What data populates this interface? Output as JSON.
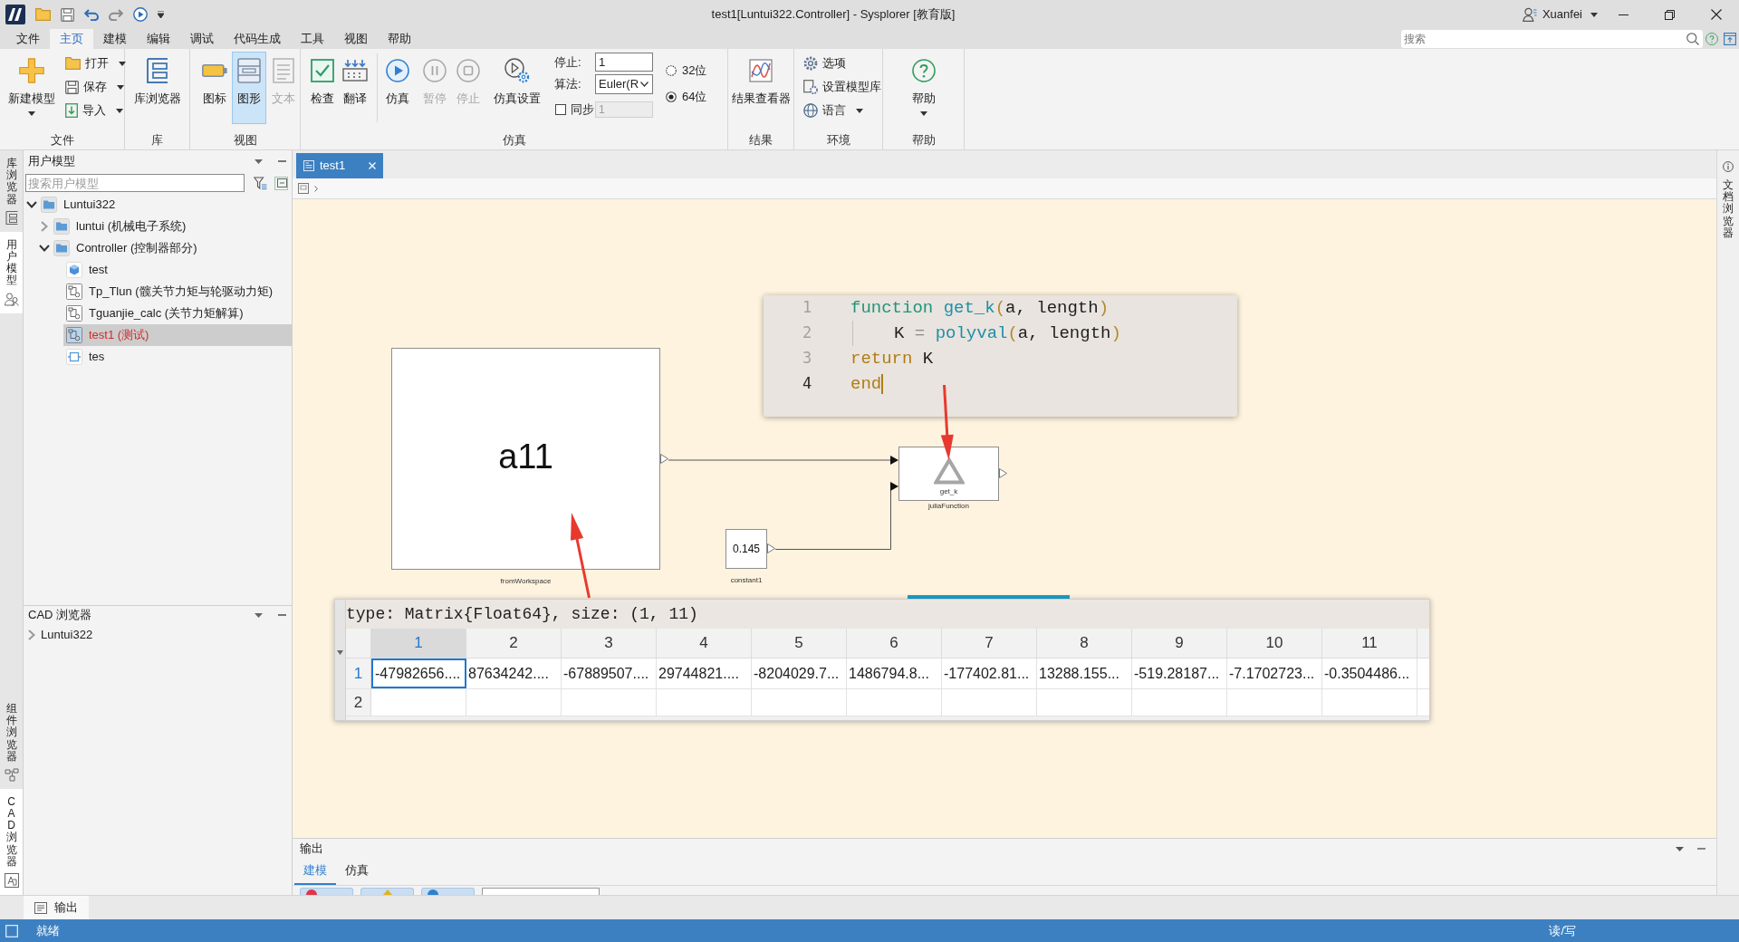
{
  "window": {
    "title": "test1[Luntui322.Controller] - Sysplorer [教育版]",
    "user": "Xuanfei"
  },
  "menu_tabs": [
    {
      "label": "文件",
      "selected": false
    },
    {
      "label": "主页",
      "selected": true
    },
    {
      "label": "建模",
      "selected": false
    },
    {
      "label": "编辑",
      "selected": false
    },
    {
      "label": "调试",
      "selected": false
    },
    {
      "label": "代码生成",
      "selected": false
    },
    {
      "label": "工具",
      "selected": false
    },
    {
      "label": "视图",
      "selected": false
    },
    {
      "label": "帮助",
      "selected": false
    }
  ],
  "global_search": {
    "placeholder": "搜索"
  },
  "ribbon": {
    "file_group": {
      "label": "文件",
      "new_model": {
        "label": "新建模型",
        "dropdown": true
      },
      "actions": [
        {
          "label": "打开",
          "dropdown": true
        },
        {
          "label": "保存",
          "dropdown": true
        },
        {
          "label": "导入",
          "dropdown": true
        }
      ]
    },
    "library_group": {
      "label": "库",
      "library_browser": {
        "label": "库浏览器"
      }
    },
    "view_group": {
      "label": "视图",
      "buttons": [
        {
          "label": "图标",
          "selected": false,
          "disabled": false
        },
        {
          "label": "图形",
          "selected": true,
          "disabled": false
        },
        {
          "label": "文本",
          "selected": false,
          "disabled": true
        }
      ]
    },
    "simulation_group": {
      "label": "仿真",
      "tools": [
        {
          "label": "检查"
        },
        {
          "label": "翻译"
        }
      ],
      "run_buttons": [
        {
          "label": "仿真",
          "disabled": false
        },
        {
          "label": "暂停",
          "disabled": true
        },
        {
          "label": "停止",
          "disabled": true
        }
      ],
      "settings": {
        "label": "仿真设置"
      },
      "stop_time": {
        "label": "停止:",
        "value": "1"
      },
      "algorithm": {
        "label": "算法:",
        "value": "Euler(R"
      },
      "sync": {
        "label": "同步",
        "checked": false
      },
      "sync_value": {
        "value": "1",
        "disabled": true
      },
      "precision": [
        {
          "label": "32位",
          "selected": false
        },
        {
          "label": "64位",
          "selected": true
        }
      ]
    },
    "results_group": {
      "label": "结果",
      "viewer": {
        "label": "结果查看器"
      }
    },
    "environment_group": {
      "label": "环境",
      "items": [
        {
          "label": "选项",
          "dropdown": false
        },
        {
          "label": "设置模型库",
          "dropdown": false
        },
        {
          "label": "语言",
          "dropdown": true
        }
      ]
    },
    "help_group": {
      "label": "帮助",
      "help": {
        "label": "帮助",
        "dropdown": true
      }
    }
  },
  "left_dock": {
    "top_tabs": [
      {
        "label": "库浏览器",
        "selected": false
      },
      {
        "label": "用户模型",
        "selected": true
      }
    ],
    "bottom_tabs": [
      {
        "label": "组件浏览器",
        "selected": false
      },
      {
        "label": "CAD 浏览器",
        "selected": true
      }
    ]
  },
  "user_models": {
    "title": "用户模型",
    "search": {
      "placeholder": "搜索用户模型"
    },
    "tree": [
      {
        "label": "Luntui322",
        "kind": "package",
        "expanded": true,
        "selected": false,
        "children": [
          {
            "label": "luntui (机械电子系统)",
            "kind": "package",
            "expanded": false,
            "selected": false
          },
          {
            "label": "Controller (控制器部分)",
            "kind": "package",
            "expanded": true,
            "selected": false,
            "children": [
              {
                "label": "test",
                "kind": "class",
                "selected": false
              },
              {
                "label": "Tp_Tlun (髋关节力矩与轮驱动力矩)",
                "kind": "model",
                "selected": false
              },
              {
                "label": "Tguanjie_calc (关节力矩解算)",
                "kind": "model",
                "selected": false
              },
              {
                "label": "test1 (测试)",
                "kind": "model",
                "selected": true
              },
              {
                "label": "tes",
                "kind": "block",
                "selected": false
              }
            ]
          }
        ]
      }
    ]
  },
  "cad_browser": {
    "title": "CAD 浏览器",
    "tree": [
      {
        "label": "Luntui322",
        "expanded": false,
        "selected": false
      }
    ]
  },
  "document_tabs": [
    {
      "label": "test1",
      "selected": true
    }
  ],
  "diagram": {
    "blocks": [
      {
        "kind": "from_workspace",
        "text": "a11",
        "name": "fromWorkspace"
      },
      {
        "kind": "constant",
        "text": "0.145",
        "name": "constant1"
      },
      {
        "kind": "julia_function",
        "text": "get_k",
        "name": "juliaFunction"
      }
    ]
  },
  "code_popup": {
    "lines": [
      {
        "number": "1",
        "current": false,
        "indent": false,
        "tokens": [
          {
            "text": "function ",
            "kind": "keyword"
          },
          {
            "text": "get_k",
            "kind": "name"
          },
          {
            "text": "(",
            "kind": "paren"
          },
          {
            "text": "a, length",
            "kind": "plain"
          },
          {
            "text": ")",
            "kind": "paren"
          }
        ]
      },
      {
        "number": "2",
        "current": false,
        "indent": true,
        "tokens": [
          {
            "text": "K ",
            "kind": "plain"
          },
          {
            "text": "= ",
            "kind": "operator"
          },
          {
            "text": "polyval",
            "kind": "name"
          },
          {
            "text": "(",
            "kind": "paren"
          },
          {
            "text": "a, length",
            "kind": "plain"
          },
          {
            "text": ")",
            "kind": "paren"
          }
        ]
      },
      {
        "number": "3",
        "current": false,
        "indent": false,
        "tokens": [
          {
            "text": "return ",
            "kind": "flow"
          },
          {
            "text": "K",
            "kind": "plain"
          }
        ]
      },
      {
        "number": "4",
        "current": true,
        "indent": false,
        "tokens": [
          {
            "text": "end",
            "kind": "flow"
          }
        ]
      }
    ]
  },
  "matrix_view": {
    "title": "type: Matrix{Float64}, size: (1, 11)",
    "columns": [
      "1",
      "2",
      "3",
      "4",
      "5",
      "6",
      "7",
      "8",
      "9",
      "10",
      "11"
    ],
    "rows": [
      {
        "label": "1",
        "cells": [
          {
            "text": "-47982656....",
            "selected": true
          },
          {
            "text": "87634242....",
            "selected": false
          },
          {
            "text": "-67889507....",
            "selected": false
          },
          {
            "text": "29744821....",
            "selected": false
          },
          {
            "text": "-8204029.7...",
            "selected": false
          },
          {
            "text": "1486794.8...",
            "selected": false
          },
          {
            "text": "-177402.81...",
            "selected": false
          },
          {
            "text": "13288.155...",
            "selected": false
          },
          {
            "text": "-519.28187...",
            "selected": false
          },
          {
            "text": "-7.1702723...",
            "selected": false
          },
          {
            "text": "-0.3504486...",
            "selected": false
          }
        ]
      },
      {
        "label": "2"
      }
    ]
  },
  "right_dock": {
    "tabs": [
      {
        "label": "文档浏览器",
        "selected": false
      }
    ]
  },
  "output_panel": {
    "title": "输出",
    "tabs": [
      {
        "label": "建模",
        "selected": true
      },
      {
        "label": "仿真",
        "selected": false
      }
    ]
  },
  "bottom_tabs": [
    {
      "label": "输出",
      "selected": true
    }
  ],
  "status_bar": {
    "status": "就绪",
    "access": "读/写"
  }
}
